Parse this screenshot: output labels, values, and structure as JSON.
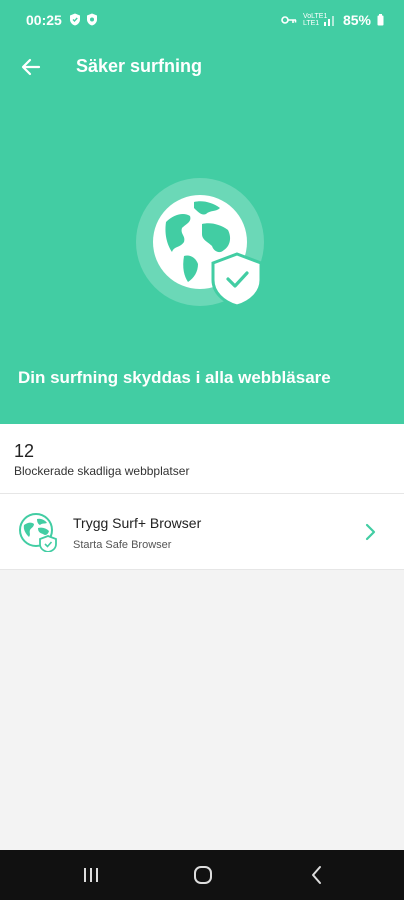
{
  "status_bar": {
    "time": "00:25",
    "network": "VoLTE1 LTE1",
    "battery": "85%"
  },
  "app_bar": {
    "title": "Säker surfning",
    "back_icon": "arrow-left-icon"
  },
  "hero": {
    "illustration": "globe-shield-icon",
    "message": "Din surfning skyddas i alla webbläsare"
  },
  "stats": {
    "blocked_count": "12",
    "blocked_label": "Blockerade skadliga webbplatser"
  },
  "browser_item": {
    "title": "Trygg Surf+ Browser",
    "subtitle": "Starta Safe Browser",
    "icon": "globe-shield-icon",
    "chevron": "chevron-right-icon"
  },
  "colors": {
    "accent": "#42cda3",
    "accent_dark": "#2fbf93",
    "background": "#f3f3f3",
    "nav_bar": "#111111"
  },
  "nav_bar": {
    "recent_icon": "recent-apps-icon",
    "home_icon": "home-icon",
    "back_icon": "back-icon"
  }
}
